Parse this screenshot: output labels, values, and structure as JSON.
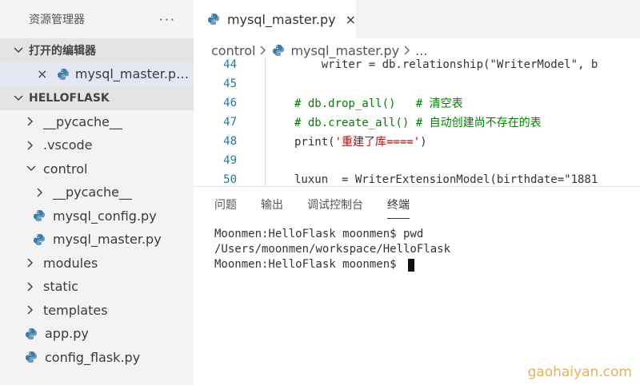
{
  "sidebar": {
    "title": "资源管理器",
    "more_label": "···",
    "open_editors": {
      "header": "打开的编辑器",
      "items": [
        {
          "close": "×",
          "label": "mysql_master.py..."
        }
      ]
    },
    "folder": {
      "header": "HELLOFLASK",
      "items": [
        {
          "label": "__pycache__"
        },
        {
          "label": ".vscode"
        },
        {
          "label": "control"
        },
        {
          "label": "__pycache__"
        },
        {
          "label": "mysql_config.py"
        },
        {
          "label": "mysql_master.py"
        },
        {
          "label": "modules"
        },
        {
          "label": "static"
        },
        {
          "label": "templates"
        },
        {
          "label": "app.py"
        },
        {
          "label": "config_flask.py"
        }
      ]
    }
  },
  "editor": {
    "tab": {
      "label": "mysql_master.py",
      "close": "×"
    },
    "breadcrumb": {
      "folder": "control",
      "file": "mysql_master.py",
      "more": "..."
    },
    "lines": [
      {
        "num": "44",
        "text": "    writer = db.relationship(\"WriterModel\", b"
      },
      {
        "num": "45",
        "text": ""
      },
      {
        "num": "46",
        "text": "# db.drop_all()   # 清空表"
      },
      {
        "num": "47",
        "text": "# db.create_all() # 自动创建尚不存在的表"
      },
      {
        "num": "48",
        "code": "print(",
        "str": "'重建了库===='",
        "tail": ")"
      },
      {
        "num": "49",
        "text": ""
      },
      {
        "num": "50",
        "text": "luxun  = WriterExtensionModel(birthdate=\"1881"
      }
    ]
  },
  "panel": {
    "tabs": [
      "问题",
      "输出",
      "调试控制台",
      "终端"
    ],
    "terminal": [
      "Moonmen:HelloFlask moonmen$ pwd",
      "/Users/moonmen/workspace/HelloFlask",
      "Moonmen:HelloFlask moonmen$ "
    ]
  },
  "watermark": "gaohaiyan.com",
  "colors": {
    "sidebar_bg": "#f3f3f3",
    "section_bg": "#e4e4e4",
    "selected_bg": "#e4e6f1",
    "python_icon": "#3c7ba6",
    "line_number": "#237893",
    "comment": "#008000",
    "string": "#a31515",
    "watermark": "#e6a23c"
  }
}
